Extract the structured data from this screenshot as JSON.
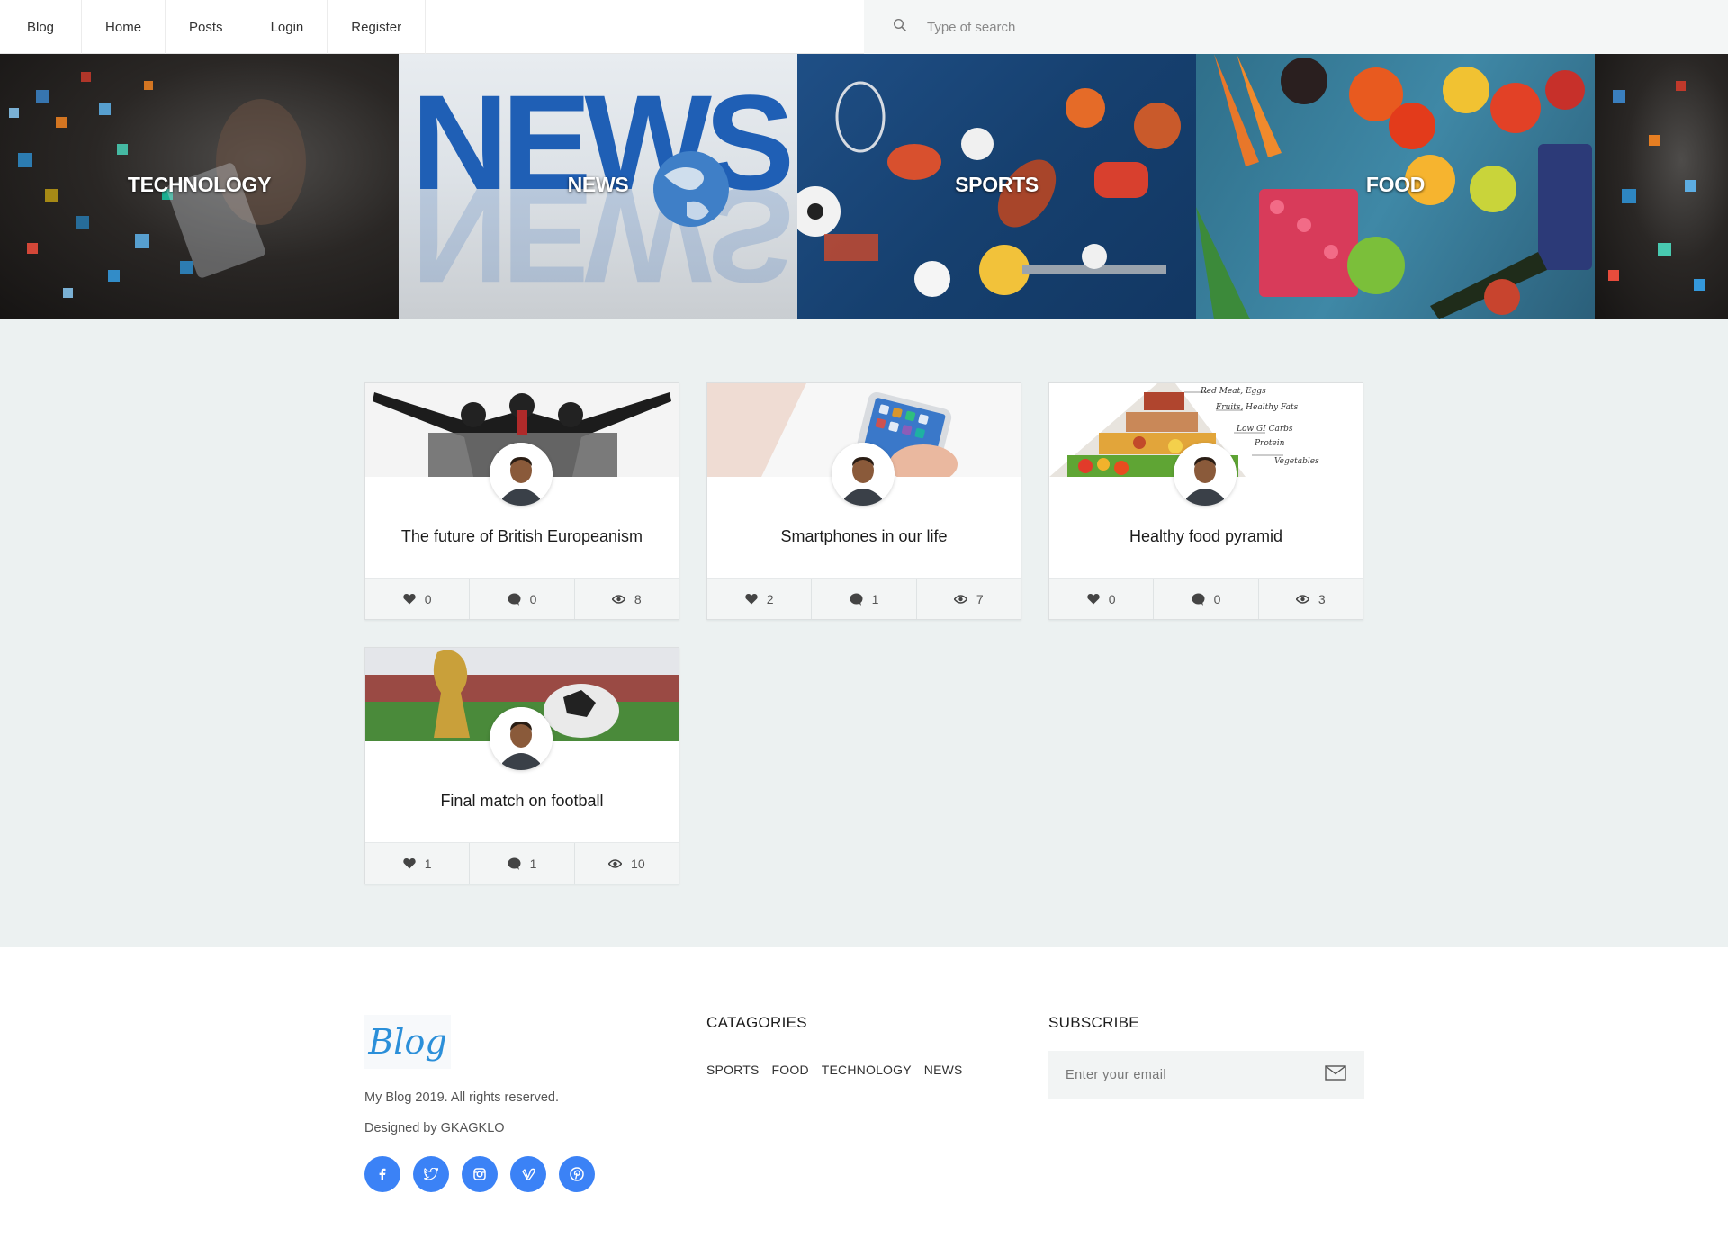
{
  "nav": {
    "brand": "Blog",
    "items": [
      "Home",
      "Posts",
      "Login",
      "Register"
    ]
  },
  "search": {
    "placeholder": "Type of search"
  },
  "categories": [
    "TECHNOLOGY",
    "NEWS",
    "SPORTS",
    "FOOD"
  ],
  "posts": [
    {
      "title": "The future of British Europeanism",
      "likes": "0",
      "comments": "0",
      "views": "8"
    },
    {
      "title": "Smartphones in our life",
      "likes": "2",
      "comments": "1",
      "views": "7"
    },
    {
      "title": "Healthy food pyramid",
      "likes": "0",
      "comments": "0",
      "views": "3"
    },
    {
      "title": "Final match on football",
      "likes": "1",
      "comments": "1",
      "views": "10"
    }
  ],
  "footer": {
    "logo": "Blog",
    "rights": "My Blog 2019. All rights reserved.",
    "designed": "Designed by GKAGKLO",
    "social": [
      "facebook-icon",
      "twitter-icon",
      "instagram-icon",
      "vimeo-icon",
      "pinterest-icon"
    ],
    "categories_heading": "CATAGORIES",
    "category_links": [
      "SPORTS",
      "FOOD",
      "TECHNOLOGY",
      "NEWS"
    ],
    "subscribe_heading": "SUBSCRIBE",
    "email_placeholder": "Enter your email"
  },
  "colors": {
    "accent": "#3b82f6",
    "main_bg": "#ecf1f1",
    "search_bg": "#f4f6f6"
  }
}
